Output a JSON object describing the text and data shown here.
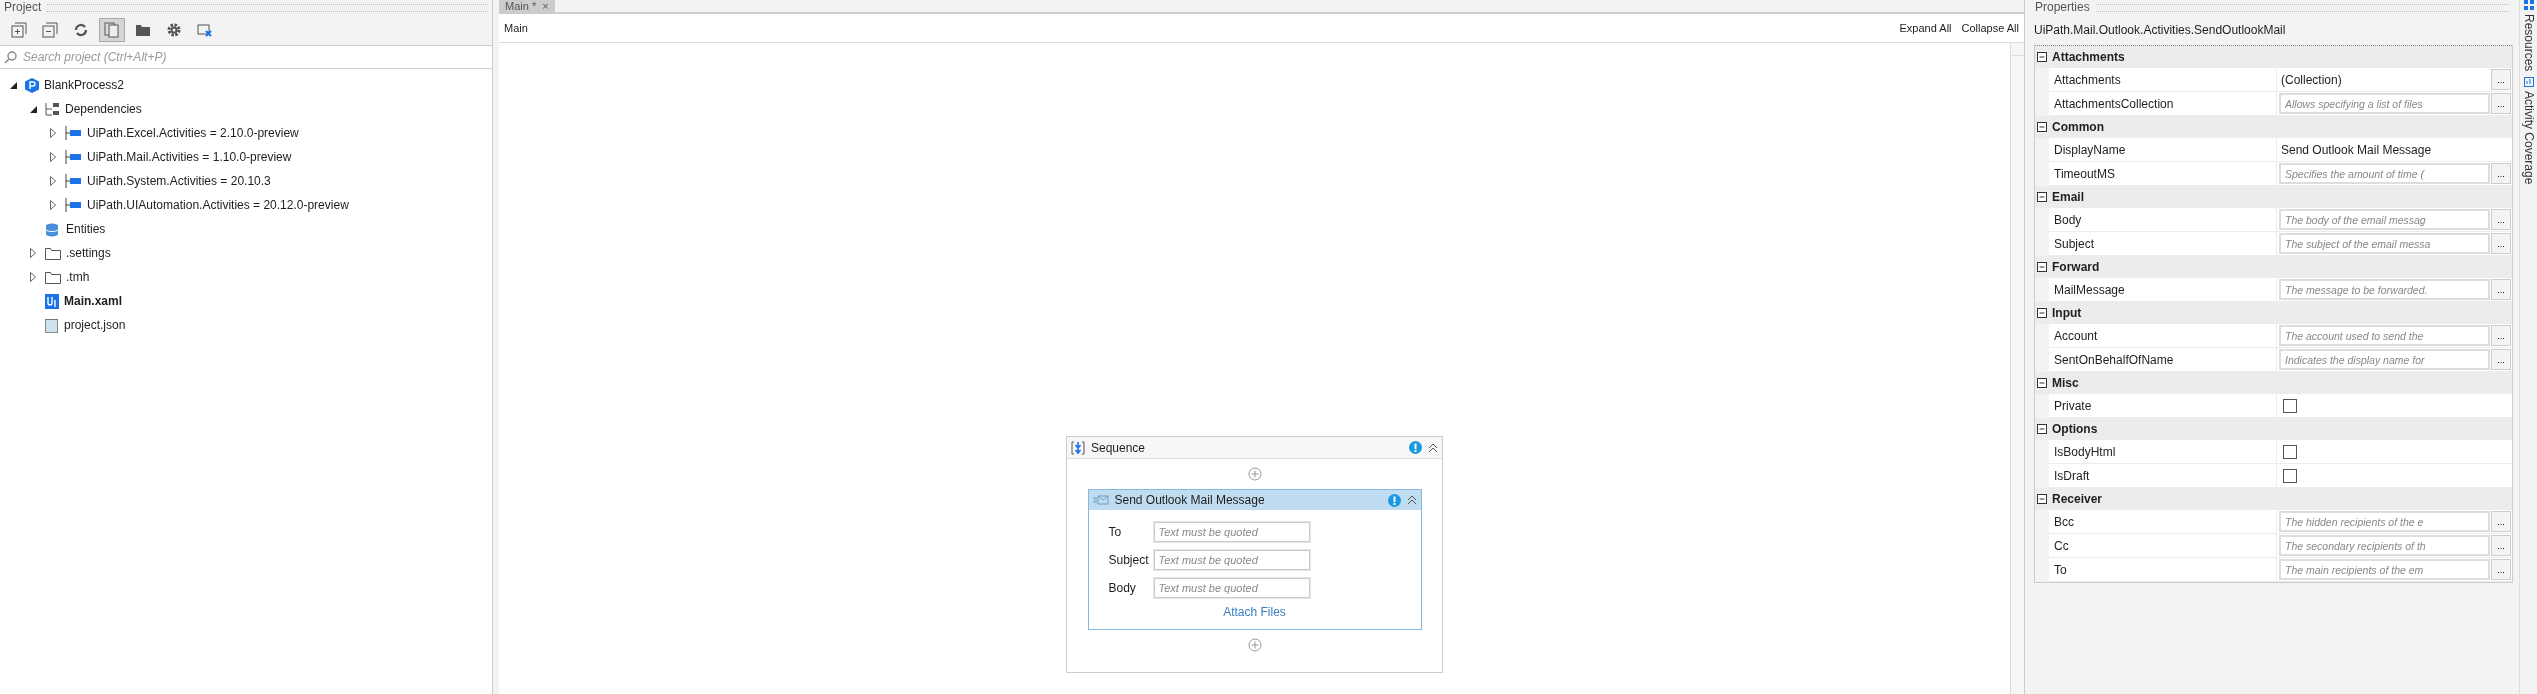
{
  "project": {
    "title": "Project",
    "toolbar": [
      {
        "kind": "expand",
        "selected": false
      },
      {
        "kind": "collapse",
        "selected": false
      },
      {
        "kind": "refresh",
        "selected": false
      },
      {
        "kind": "show-all",
        "selected": true
      },
      {
        "kind": "folder",
        "selected": false
      },
      {
        "kind": "settings",
        "selected": false
      },
      {
        "kind": "remove",
        "selected": false
      }
    ],
    "search": {
      "placeholder": "Search project (Ctrl+Alt+P)"
    },
    "tree": [
      {
        "label": "BlankProcess2",
        "kind": "project",
        "expanded": true,
        "children": [
          {
            "label": "Dependencies",
            "kind": "dependencies",
            "expanded": true,
            "children": [
              {
                "label": "UiPath.Excel.Activities = 2.10.0-preview",
                "kind": "package",
                "expanded": false
              },
              {
                "label": "UiPath.Mail.Activities = 1.10.0-preview",
                "kind": "package",
                "expanded": false
              },
              {
                "label": "UiPath.System.Activities = 20.10.3",
                "kind": "package",
                "expanded": false
              },
              {
                "label": "UiPath.UIAutomation.Activities = 20.12.0-preview",
                "kind": "package",
                "expanded": false
              }
            ]
          },
          {
            "label": "Entities",
            "kind": "entities"
          },
          {
            "label": ".settings",
            "kind": "folder",
            "expanded": false
          },
          {
            "label": ".tmh",
            "kind": "folder",
            "expanded": false
          },
          {
            "label": "Main.xaml",
            "kind": "workflow"
          },
          {
            "label": "project.json",
            "kind": "json"
          }
        ]
      }
    ]
  },
  "designer": {
    "tab": {
      "label": "Main *",
      "close": "×",
      "selected": true
    },
    "breadcrumb": "Main",
    "actions": [
      "Expand All",
      "Collapse All"
    ],
    "sequence": {
      "title": "Sequence",
      "activity": {
        "title": "Send Outlook Mail Message",
        "fields": [
          {
            "label": "To",
            "placeholder": "Text must be quoted"
          },
          {
            "label": "Subject",
            "placeholder": "Text must be quoted"
          },
          {
            "label": "Body",
            "placeholder": "Text must be quoted"
          }
        ],
        "link": "Attach Files"
      }
    }
  },
  "properties": {
    "title": "Properties",
    "type_name": "UiPath.Mail.Outlook.Activities.SendOutlookMail",
    "categories": [
      {
        "name": "Attachments",
        "expanded": true,
        "props": [
          {
            "name": "Attachments",
            "kind": "value",
            "value": "(Collection)",
            "button": "..."
          },
          {
            "name": "AttachmentsCollection",
            "kind": "hint",
            "placeholder": "Allows specifying a list of files",
            "button": "..."
          }
        ]
      },
      {
        "name": "Common",
        "expanded": true,
        "props": [
          {
            "name": "DisplayName",
            "kind": "plain",
            "value": "Send Outlook Mail Message"
          },
          {
            "name": "TimeoutMS",
            "kind": "hint",
            "placeholder": "Specifies the amount of time (",
            "button": "..."
          }
        ]
      },
      {
        "name": "Email",
        "expanded": true,
        "props": [
          {
            "name": "Body",
            "kind": "hint",
            "placeholder": "The body of the email messag",
            "button": "..."
          },
          {
            "name": "Subject",
            "kind": "hint",
            "placeholder": "The subject of the email messa",
            "button": "..."
          }
        ]
      },
      {
        "name": "Forward",
        "expanded": true,
        "props": [
          {
            "name": "MailMessage",
            "kind": "hint",
            "placeholder": "The message to be forwarded.",
            "button": "..."
          }
        ]
      },
      {
        "name": "Input",
        "expanded": true,
        "props": [
          {
            "name": "Account",
            "kind": "hint",
            "placeholder": "The account used to send the",
            "button": "..."
          },
          {
            "name": "SentOnBehalfOfName",
            "kind": "hint",
            "placeholder": "Indicates the display name for",
            "button": "..."
          }
        ]
      },
      {
        "name": "Misc",
        "expanded": true,
        "props": [
          {
            "name": "Private",
            "kind": "checkbox",
            "checked": false
          }
        ]
      },
      {
        "name": "Options",
        "expanded": true,
        "props": [
          {
            "name": "IsBodyHtml",
            "kind": "checkbox",
            "checked": false
          },
          {
            "name": "IsDraft",
            "kind": "checkbox",
            "checked": false
          }
        ]
      },
      {
        "name": "Receiver",
        "expanded": true,
        "props": [
          {
            "name": "Bcc",
            "kind": "hint",
            "placeholder": "The hidden recipients of the e",
            "button": "..."
          },
          {
            "name": "Cc",
            "kind": "hint",
            "placeholder": "The secondary recipients of th",
            "button": "..."
          },
          {
            "name": "To",
            "kind": "hint",
            "placeholder": "The main recipients of the em",
            "button": "..."
          }
        ]
      }
    ]
  },
  "side_tabs": [
    {
      "label": "Resources",
      "kind": "resources"
    },
    {
      "label": "Activity Coverage",
      "kind": "coverage"
    }
  ]
}
